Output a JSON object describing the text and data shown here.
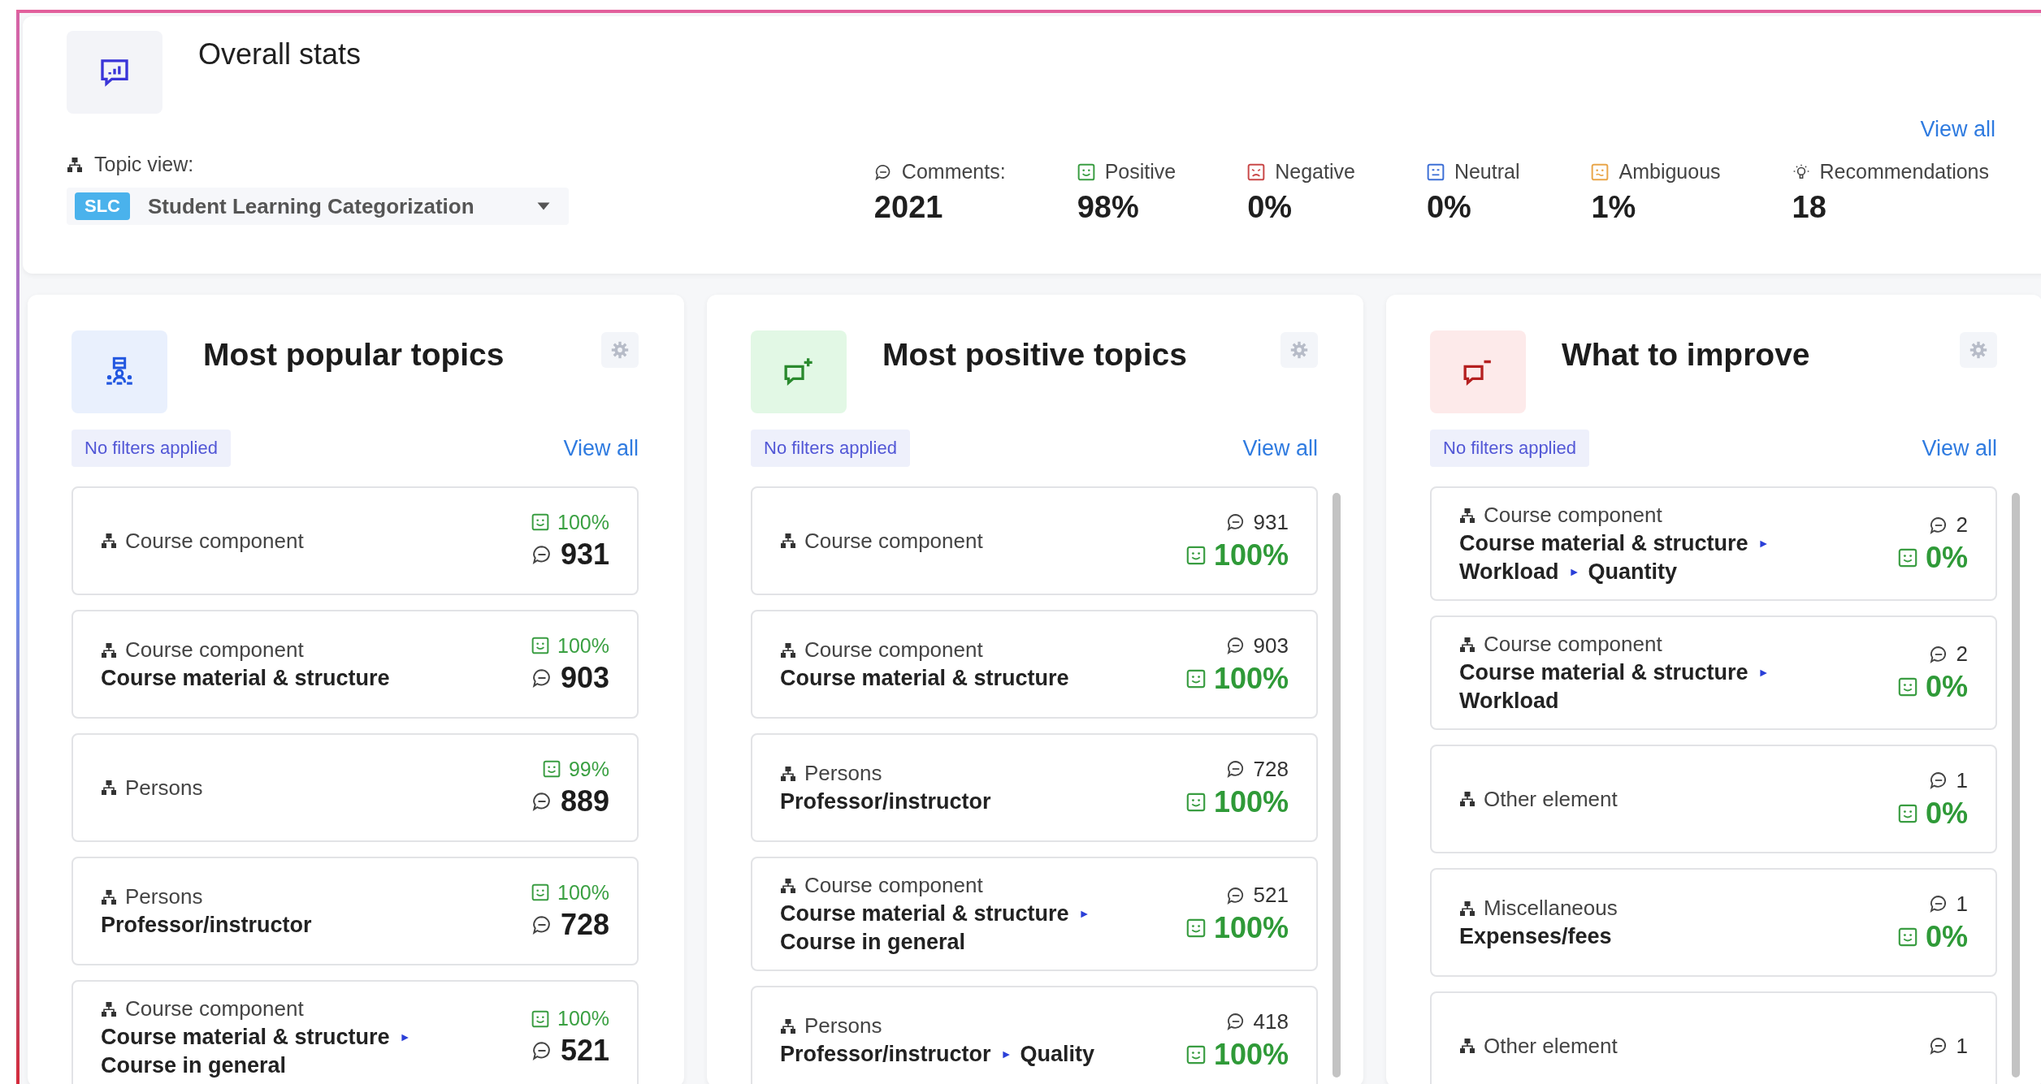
{
  "overall": {
    "title": "Overall stats",
    "view_all": "View all",
    "topic_view": {
      "label": "Topic view:",
      "badge": "SLC",
      "value": "Student Learning Categorization"
    },
    "stats": [
      {
        "kind": "comments",
        "label": "Comments:",
        "value": "2021"
      },
      {
        "kind": "positive",
        "label": "Positive",
        "value": "98%"
      },
      {
        "kind": "negative",
        "label": "Negative",
        "value": "0%"
      },
      {
        "kind": "neutral",
        "label": "Neutral",
        "value": "0%"
      },
      {
        "kind": "ambiguous",
        "label": "Ambiguous",
        "value": "1%"
      },
      {
        "kind": "recommendations",
        "label": "Recommendations",
        "value": "18"
      }
    ]
  },
  "panels": [
    {
      "kind": "popular",
      "title": "Most popular topics",
      "filter": "No filters applied",
      "view_all": "View all",
      "scrollbar": false,
      "items": [
        {
          "category": "Course component",
          "percent": "100%",
          "count": "931"
        },
        {
          "category": "Course component",
          "path": [
            "Course material & structure"
          ],
          "percent": "100%",
          "count": "903"
        },
        {
          "category": "Persons",
          "percent": "99%",
          "count": "889"
        },
        {
          "category": "Persons",
          "path": [
            "Professor/instructor"
          ],
          "percent": "100%",
          "count": "728"
        },
        {
          "category": "Course component",
          "path": [
            "Course material & structure",
            "Course in general"
          ],
          "percent": "100%",
          "count": "521"
        }
      ]
    },
    {
      "kind": "positive",
      "title": "Most positive topics",
      "filter": "No filters applied",
      "view_all": "View all",
      "scrollbar": true,
      "items": [
        {
          "category": "Course component",
          "count": "931",
          "percent": "100%"
        },
        {
          "category": "Course component",
          "path": [
            "Course material & structure"
          ],
          "count": "903",
          "percent": "100%"
        },
        {
          "category": "Persons",
          "path": [
            "Professor/instructor"
          ],
          "count": "728",
          "percent": "100%"
        },
        {
          "category": "Course component",
          "path": [
            "Course material & structure",
            "Course in general"
          ],
          "count": "521",
          "percent": "100%"
        },
        {
          "category": "Persons",
          "path": [
            "Professor/instructor",
            "Quality"
          ],
          "count": "418",
          "percent": "100%"
        }
      ]
    },
    {
      "kind": "improve",
      "title": "What to improve",
      "filter": "No filters applied",
      "view_all": "View all",
      "scrollbar": true,
      "items": [
        {
          "category": "Course component",
          "path": [
            "Course material & structure",
            "Workload",
            "Quantity"
          ],
          "count": "2",
          "percent": "0%"
        },
        {
          "category": "Course component",
          "path": [
            "Course material & structure",
            "Workload"
          ],
          "count": "2",
          "percent": "0%"
        },
        {
          "category": "Other element",
          "count": "1",
          "percent": "0%"
        },
        {
          "category": "Miscellaneous",
          "path": [
            "Expenses/fees"
          ],
          "count": "1",
          "percent": "0%"
        },
        {
          "category": "Other element",
          "count": "1"
        }
      ]
    }
  ]
}
